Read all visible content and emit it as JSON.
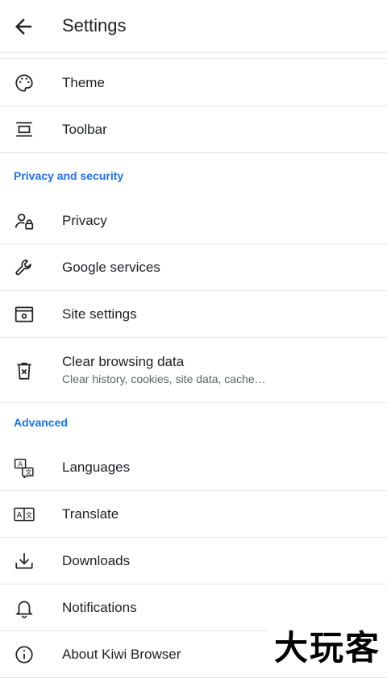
{
  "header": {
    "title": "Settings"
  },
  "sections": {
    "privacy_title": "Privacy and security",
    "advanced_title": "Advanced"
  },
  "rows": {
    "theme": "Theme",
    "toolbar": "Toolbar",
    "privacy": "Privacy",
    "google_services": "Google services",
    "site_settings": "Site settings",
    "clear_browsing": "Clear browsing data",
    "clear_browsing_sub": "Clear history, cookies, site data, cache…",
    "languages": "Languages",
    "translate": "Translate",
    "downloads": "Downloads",
    "notifications": "Notifications",
    "about": "About Kiwi Browser"
  },
  "watermark": {
    "text": "大玩客"
  },
  "colors": {
    "accent": "#1a73e8",
    "text": "#202124",
    "subtext": "#5f6368",
    "divider": "#e6e6e6"
  }
}
